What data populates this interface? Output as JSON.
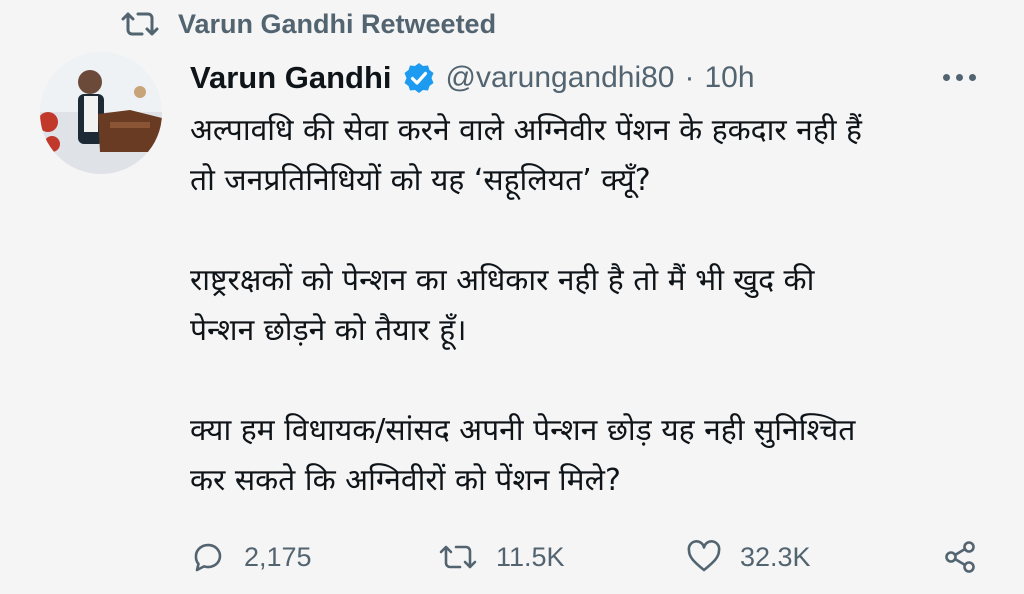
{
  "retweet": {
    "label": "Varun Gandhi Retweeted",
    "icon": "retweet-icon"
  },
  "tweet": {
    "author_name": "Varun Gandhi",
    "verified": true,
    "handle": "@varungandhi80",
    "separator": "·",
    "time": "10h",
    "lines": [
      "अल्पावधि की सेवा करने वाले अग्निवीर पेंशन के हकदार नही हैं",
      "तो जनप्रतिनिधियों को यह ‘सहूलियत’ क्यूँ?",
      "राष्ट्ररक्षकों को पेन्शन का अधिकार नही है तो मैं भी खुद की",
      "पेन्शन छोड़ने को तैयार हूँ।",
      "क्या हम विधायक/सांसद अपनी पेन्शन छोड़ यह नही सुनिश्चित",
      "कर सकते कि अग्निवीरों को पेंशन मिले?"
    ]
  },
  "actions": {
    "replies": "2,175",
    "retweets": "11.5K",
    "likes": "32.3K"
  },
  "colors": {
    "muted": "#536471",
    "verified": "#1d9bf0",
    "text": "#0f1419",
    "background": "#f5f5f5"
  }
}
